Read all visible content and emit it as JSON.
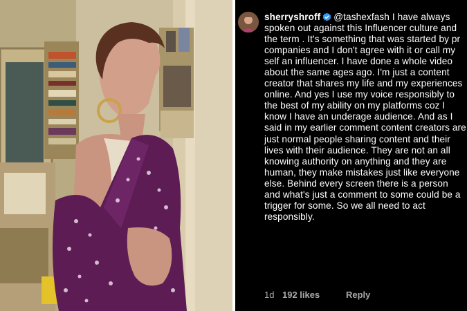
{
  "comment": {
    "username": "sherryshroff",
    "mention": "@tashexfash",
    "text": " I have always spoken out against this Influencer culture and the term . It's something that was started by pr companies and I don't agree with it or call my self an influencer. I have done a whole video about the same ages ago. I'm just a content creator that shares my life and my experiences online. And yes I use my voice responsibly to the best of my ability on my platforms coz I know I have an underage audience. And as I said in my earlier comment content creators are just normal people sharing content and their lives with their audience. They are not an all knowing authority on anything and they are human, they make mistakes just like everyone else.  Behind every screen there is a person and what's just a comment to some could be a trigger for some. So we all need to act responsibly.",
    "time": "1d",
    "likes": "192 likes",
    "reply_label": "Reply"
  },
  "icons": {
    "avatar": "profile-avatar",
    "verified": "verified-badge-icon"
  },
  "colors": {
    "background": "#000000",
    "text": "#ffffff",
    "meta": "#a8a8a8",
    "verified": "#3897f0",
    "saree": "#5e1c55"
  }
}
